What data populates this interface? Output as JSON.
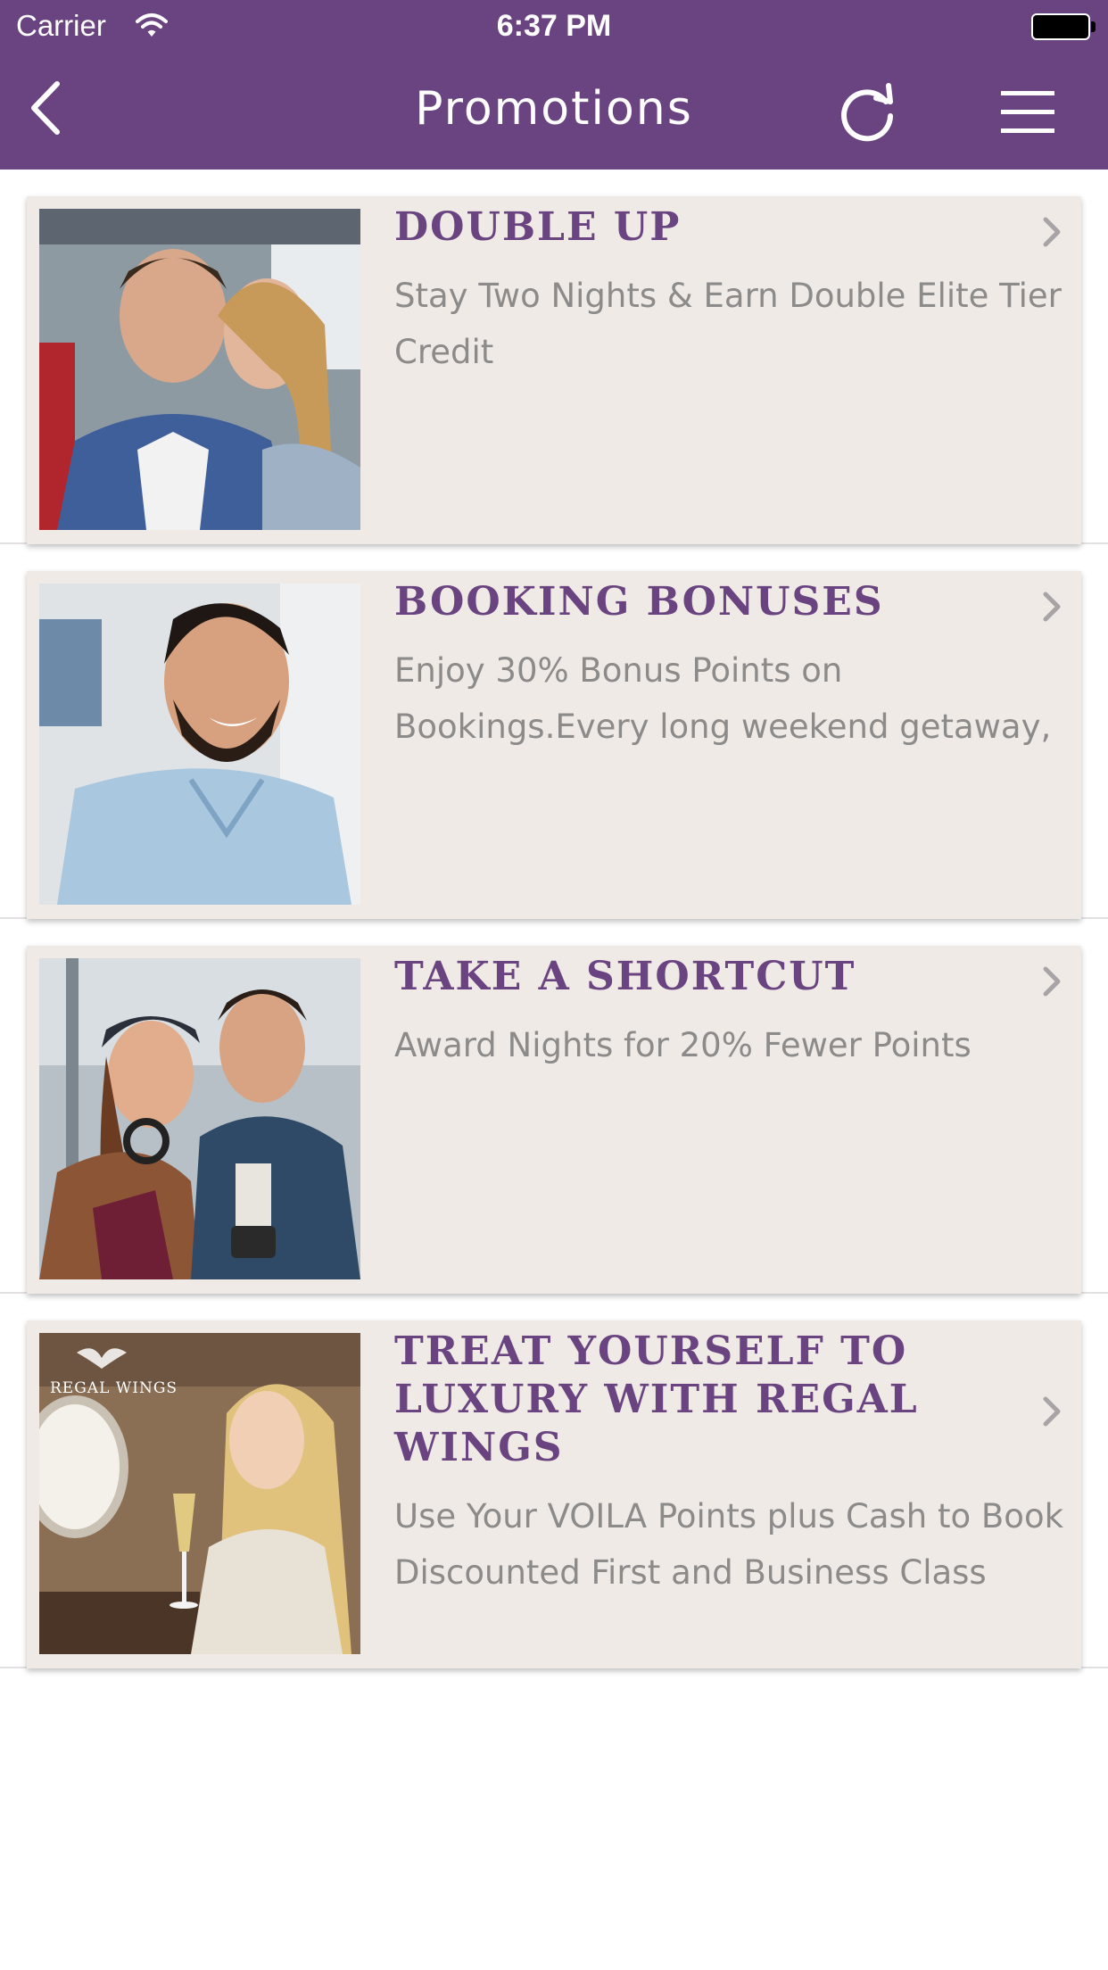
{
  "status_bar": {
    "carrier": "Carrier",
    "time": "6:37 PM"
  },
  "header": {
    "title": "Promotions",
    "background_color": "#6a4480",
    "back_icon": "chevron-left-icon",
    "refresh_icon": "refresh-icon",
    "menu_icon": "hamburger-menu-icon"
  },
  "promotions": [
    {
      "title": "DOUBLE UP",
      "description": "Stay Two Nights & Earn Double Elite Tier Credit",
      "image": "couple on a train"
    },
    {
      "title": "BOOKING BONUSES",
      "description": "Enjoy 30% Bonus Points on Bookings.Every long weekend getaway,",
      "image": "smiling bearded man"
    },
    {
      "title": "TAKE A SHORTCUT",
      "description": "Award Nights for 20% Fewer Points",
      "image": "couple at a station"
    },
    {
      "title": "TREAT YOURSELF TO LUXURY WITH REGAL WINGS",
      "description": "Use Your VOILA Points plus Cash to Book Discounted First and Business Class",
      "image": "woman with champagne on a private jet",
      "image_brand": "REGAL WINGS"
    }
  ],
  "colors": {
    "accent": "#6a4480",
    "card_background": "#efeae6",
    "description_text": "#8d8a8a"
  }
}
